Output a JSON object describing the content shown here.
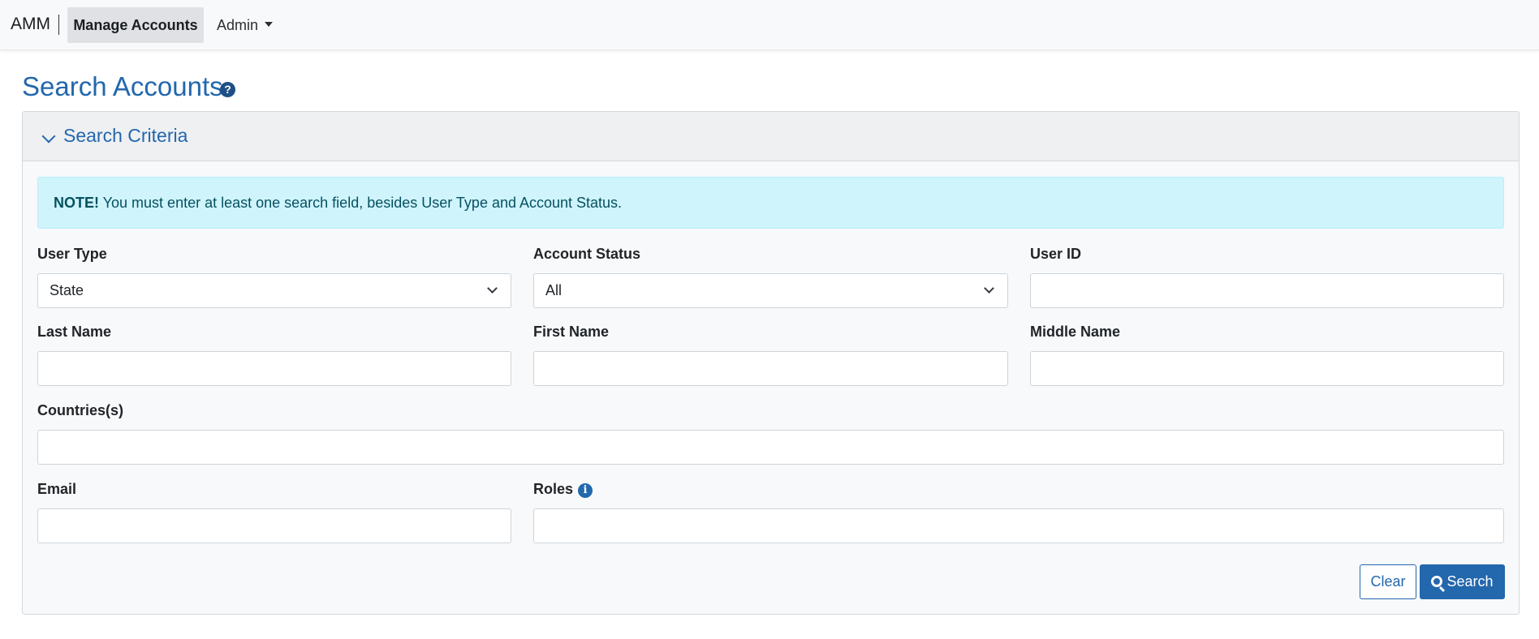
{
  "navbar": {
    "brand": "AMM",
    "active_item": "Manage Accounts",
    "admin_menu": "Admin"
  },
  "page": {
    "title": "Search Accounts",
    "help_icon": "question-circle-icon"
  },
  "criteria": {
    "header": "Search Criteria",
    "note_prefix": "NOTE!",
    "note_text": " You must enter at least one search field, besides User Type and Account Status.",
    "fields": {
      "user_type": {
        "label": "User Type",
        "value": "State"
      },
      "account_status": {
        "label": "Account Status",
        "value": "All"
      },
      "user_id": {
        "label": "User ID",
        "value": ""
      },
      "last_name": {
        "label": "Last Name",
        "value": ""
      },
      "first_name": {
        "label": "First Name",
        "value": ""
      },
      "middle_name": {
        "label": "Middle Name",
        "value": ""
      },
      "countries": {
        "label": "Countries(s)",
        "value": ""
      },
      "email": {
        "label": "Email",
        "value": ""
      },
      "roles": {
        "label": "Roles",
        "value": ""
      }
    },
    "buttons": {
      "clear": "Clear",
      "search": "Search"
    }
  },
  "colors": {
    "primary": "#2367ad",
    "alert_bg": "#cff4fc",
    "alert_text": "#055160",
    "card_bg": "#f8f9fa"
  }
}
